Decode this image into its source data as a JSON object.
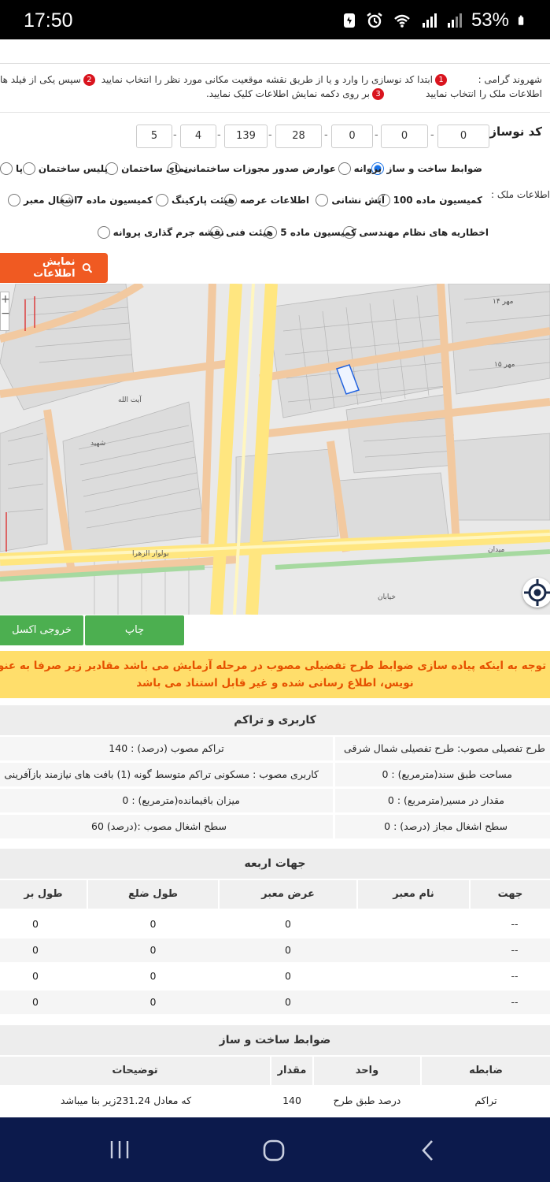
{
  "status_bar": {
    "time": "17:50",
    "battery": "53%"
  },
  "instructions": {
    "greeting": "شهروند گرامی :",
    "step1_text": "ابتدا کد نوسازی را وارد و یا از طریق نقشه موقعیت مکانی مورد نظر را انتخاب نمایید",
    "step2_text": "سپس یکی از فیلد ها",
    "step2_cont": "اطلاعات ملک را انتخاب نمایید",
    "step3_text": "بر روی دکمه نمایش اطلاعات کلیک نمایید."
  },
  "code": {
    "label": "کد نوسازی :",
    "values": [
      "0",
      "0",
      "0",
      "28",
      "139",
      "4",
      "5"
    ]
  },
  "property_info_label": "اطلاعات ملک :",
  "options": {
    "row1": [
      "ضوابط ساخت و ساز",
      "پروانه",
      "عوارض صدور مجوزات ساختمانی",
      "نمای ساختمان",
      "پلیس ساختمان",
      "پا"
    ],
    "row2": [
      "کمیسیون ماده 100",
      "آتش نشانی",
      "اطلاعات عرصه",
      "هیئت پارکینگ",
      "کمیسیون ماده 7",
      "اشغال معبر"
    ],
    "row3": [
      "اخطاریه های نظام مهندسی",
      "کمیسیون ماده 5",
      "هیئت فنی",
      "نقشه جرم گذاری پروانه"
    ]
  },
  "show_button": "نمایش اطلاعات",
  "map_labels": {
    "boulevard": "بولوار الزهرا",
    "mehr14": "مهر ۱۴",
    "mehr15": "مهر ۱۵",
    "ayatollah": "آیت الله",
    "shahid": "شهید",
    "square": "میدان",
    "street": "خیابان"
  },
  "actions": {
    "print": "چاپ",
    "excel": "خروجی اکسل"
  },
  "warning": {
    "line1": "با توجه به اینکه پیاده سازی ضوابط طرح تفضیلی مصوب در مرحله آزمایش می باشد مقادیر زیر صرفا به عنوان پیش",
    "line2": "نویس، اطلاع رسانی شده و غیر قابل استناد می باشد"
  },
  "usage_section": {
    "title": "کاربری و تراکم",
    "cells": [
      "طرح تفصیلی مصوب: طرح تفصیلی شمال شرقی",
      "تراکم مصوب (درصد) : 140",
      "مساحت طبق سند(مترمربع) : 0",
      "کاربری مصوب : مسکونی تراکم متوسط گونه (1) بافت های نیازمند بازآفرینی",
      "مقدار در مسیر(مترمربع) : 0",
      "میزان باقیمانده(مترمربع) : 0",
      "سطح اشغال مجاز (درصد) : 0",
      "سطح اشغال مصوب :(درصد) 60"
    ]
  },
  "directions_section": {
    "title": "جهات اربعه",
    "headers": [
      "جهت",
      "نام معبر",
      "عرض معبر",
      "طول ضلع",
      "طول بر"
    ],
    "rows": [
      [
        "--",
        "",
        "0",
        "0",
        "0"
      ],
      [
        "--",
        "",
        "0",
        "0",
        "0"
      ],
      [
        "--",
        "",
        "0",
        "0",
        "0"
      ],
      [
        "--",
        "",
        "0",
        "0",
        "0"
      ]
    ]
  },
  "rules_section": {
    "title": "ضوابط ساخت و ساز",
    "headers": [
      "ضابطه",
      "واحد",
      "مقدار",
      "توضیحات"
    ],
    "rows": [
      [
        "تراکم",
        "درصد طبق طرح",
        "140",
        "که معادل 231.24زیر بنا میباشد"
      ]
    ]
  }
}
